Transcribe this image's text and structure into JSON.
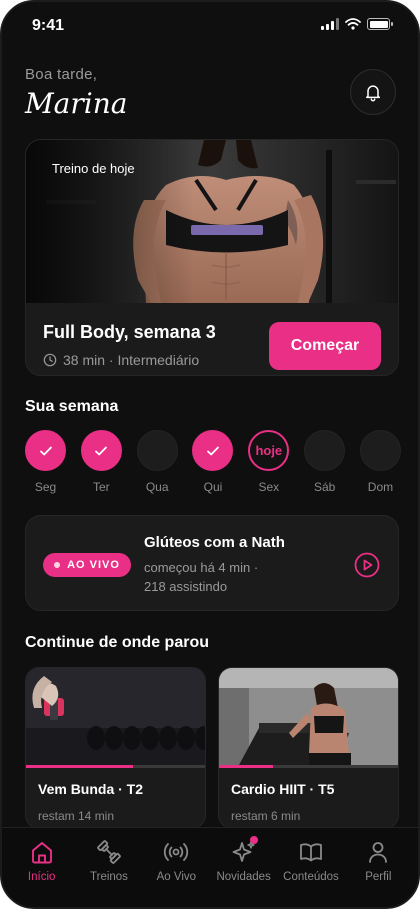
{
  "status_bar": {
    "time": "9:41"
  },
  "greeting": {
    "hello": "Boa tarde,",
    "name": "Marina"
  },
  "today_workout": {
    "label": "Treino de hoje",
    "title": "Full Body, semana 3",
    "meta": "38 min · Intermediário",
    "start_label": "Começar"
  },
  "week": {
    "title": "Sua semana",
    "days": [
      {
        "label": "Seg",
        "done": true
      },
      {
        "label": "Ter",
        "done": true
      },
      {
        "label": "Qua",
        "done": false
      },
      {
        "label": "Qui",
        "done": true
      },
      {
        "label": "Sex",
        "today_label": "hoje"
      },
      {
        "label": "Sáb",
        "done": false
      },
      {
        "label": "Dom",
        "done": false
      }
    ]
  },
  "live": {
    "badge": "AO VIVO",
    "title": "Glúteos com a Nath",
    "line1": "começou há 4 min ·",
    "line2": "218 assistindo"
  },
  "continue": {
    "title": "Continue de onde parou",
    "items": [
      {
        "title": "Vem Bunda · T2",
        "remaining": "restam 14 min",
        "progress": 0.6
      },
      {
        "title": "Cardio HIIT · T5",
        "remaining": "restam 6 min",
        "progress": 0.3
      }
    ]
  },
  "nav": {
    "items": [
      {
        "label": "Início",
        "icon": "home-icon",
        "active": true
      },
      {
        "label": "Treinos",
        "icon": "dumbbell-icon"
      },
      {
        "label": "Ao Vivo",
        "icon": "broadcast-icon"
      },
      {
        "label": "Novidades",
        "icon": "sparkle-icon",
        "badge": true
      },
      {
        "label": "Conteúdos",
        "icon": "book-icon"
      },
      {
        "label": "Perfil",
        "icon": "profile-icon"
      }
    ]
  },
  "colors": {
    "accent": "#ea2f86",
    "background": "#0f0f0f",
    "card": "#1b1b1b"
  }
}
